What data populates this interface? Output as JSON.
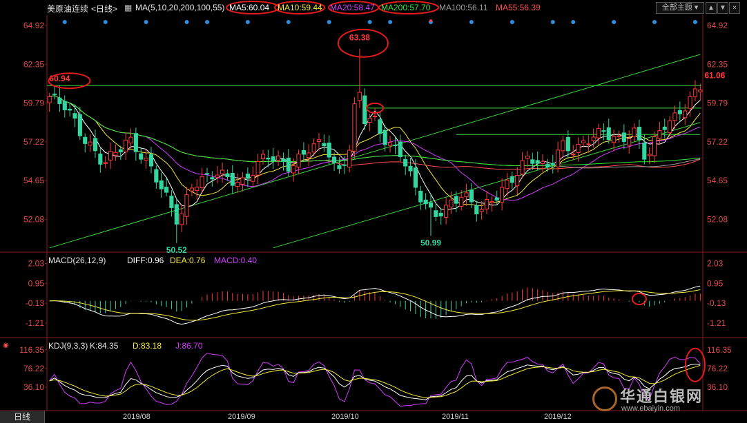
{
  "header": {
    "instrument": "美原油连续",
    "period": "<日线>",
    "ma_label": "MA(5,10,20,200,100,55)",
    "ma5": "MA5:60.04",
    "ma10": "MA10:59.44",
    "ma20": "MA20:58.47",
    "ma200": "MA200:57.70",
    "ma100": "MA100:56.11",
    "ma55": "MA55:56.39",
    "theme_button": "全部主题"
  },
  "footer": {
    "period_tab": "日线"
  },
  "watermark": {
    "text": "华通白银网",
    "url": "www.ebaiyin.com"
  },
  "colors": {
    "up": "#ff3b3b",
    "down": "#33d6a0",
    "ma5": "#ffffff",
    "ma10": "#f5e93b",
    "ma20": "#d23cff",
    "ma200": "#35e635",
    "ma100": "#9a9a9a",
    "ma55": "#ff4d4d",
    "channel": "#3ad63a",
    "marker_ellipse": "#e31b1b"
  },
  "chart_data": [
    {
      "type": "candlestick",
      "name": "price",
      "y_ticks": [
        "64.92",
        "62.35",
        "59.79",
        "57.22",
        "54.65",
        "52.08"
      ],
      "ylim": [
        50.1,
        65.6
      ],
      "x_ticks": [
        "2019/08",
        "2019/09",
        "2019/10",
        "2019/11",
        "2019/12"
      ],
      "annotations": [
        {
          "text": "60.94",
          "value": 60.94
        },
        {
          "text": "63.38",
          "value": 63.38
        },
        {
          "text": "50.52",
          "value": 50.52
        },
        {
          "text": "50.99",
          "value": 50.99
        },
        {
          "text": "61.06",
          "value": 61.06
        }
      ],
      "horizontal_lines": [
        60.94,
        59.45,
        57.7
      ],
      "channel_lines": [
        {
          "from": [
            0,
            50.2
          ],
          "to": [
            128,
            63.0
          ]
        },
        {
          "from": [
            44,
            50.2
          ],
          "to": [
            128,
            58.5
          ]
        }
      ]
    },
    {
      "type": "line",
      "name": "macd",
      "title": "MACD(26,12,9)",
      "diff": "DIFF:0.96",
      "dea": "DEA:0.76",
      "macd": "MACD:0.40",
      "y_ticks": [
        "2.03",
        "0.95",
        "-0.13",
        "-1.21"
      ],
      "ylim": [
        -1.7,
        2.5
      ]
    },
    {
      "type": "line",
      "name": "kdj",
      "title": "KDJ(9,3,3)",
      "k": "K:84.35",
      "d": "D:83.18",
      "j": "J:86.70",
      "y_ticks": [
        "116.35",
        "76.22",
        "36.10"
      ],
      "ylim": [
        -5,
        128
      ]
    }
  ]
}
